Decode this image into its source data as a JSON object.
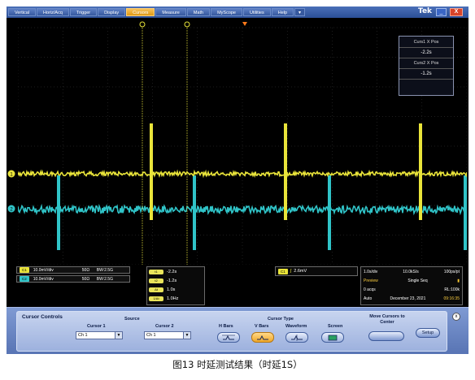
{
  "menu": {
    "items": [
      "Vertical",
      "Horiz/Acq",
      "Trigger",
      "Display",
      "Cursors",
      "Measure",
      "Math",
      "MyScope",
      "Utilities",
      "Help"
    ],
    "active": "Cursors",
    "brand": "Tek",
    "minimize_glyph": "_",
    "close_glyph": "X",
    "arrow": "▾"
  },
  "cursor_readout": {
    "curs1_label": "Curs1 X Pos",
    "curs1_value": "-2.2s",
    "curs2_label": "Curs2 X Pos",
    "curs2_value": "-1.2s"
  },
  "channels": {
    "c1": {
      "badge": "C1",
      "scale": "10.0mV/div",
      "impedance": "50Ω",
      "bw": "BW:2.5G",
      "color": "#e9e43a"
    },
    "c2": {
      "badge": "C2",
      "scale": "10.0mV/div",
      "impedance": "50Ω",
      "bw": "BW:2.5G",
      "color": "#30c4c8"
    }
  },
  "cursor_values": {
    "rows": [
      {
        "badge": "t1",
        "value": "-2.2s"
      },
      {
        "badge": "t2",
        "value": "-1.2s"
      },
      {
        "badge": "Δt",
        "value": "1.0s"
      },
      {
        "badge": "1/Δt",
        "value": "1.0Hz"
      }
    ]
  },
  "trigger": {
    "source": "C1",
    "level": "2.6mV"
  },
  "acquisition": {
    "time_div": "1.0s/div",
    "sample_rate": "10.0kS/s",
    "resolution": "100ps/pt",
    "mode": "Preview",
    "seq": "Single Seq",
    "acqs": "0 acqs",
    "record_length": "RL:100k",
    "run": "Auto",
    "date": "December 23, 2021",
    "time": "09:16:35"
  },
  "control_panel": {
    "title": "Cursor Controls",
    "source_label": "Source",
    "cursor1_label": "Cursor 1",
    "cursor1_value": "Ch 1",
    "cursor2_label": "Cursor 2",
    "cursor2_value": "Ch 1",
    "cursor_type_label": "Cursor Type",
    "types": [
      "H Bars",
      "V Bars",
      "Waveform",
      "Screen"
    ],
    "active_type": "V Bars",
    "move_label": "Move Cursors to Center",
    "setup_label": "Setup",
    "close_glyph": "x"
  },
  "caption": "图13 时延测试结果（时延1S）"
}
